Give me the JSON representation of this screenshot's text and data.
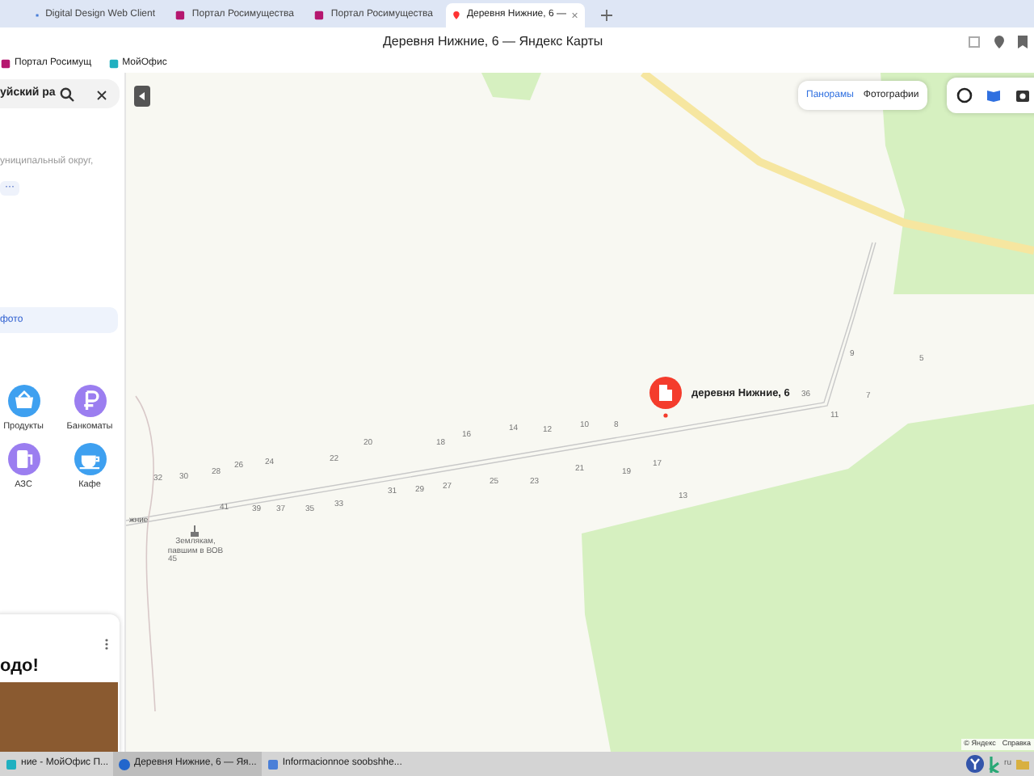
{
  "browser": {
    "tabs": [
      {
        "label": "Digital Design Web Client",
        "kind": "doc",
        "selected": false
      },
      {
        "label": "Портал Росимущества",
        "kind": "portal",
        "selected": false
      },
      {
        "label": "Портал Росимущества",
        "kind": "portal",
        "selected": false
      },
      {
        "label": "Деревня Нижние, 6 —",
        "kind": "map",
        "selected": true
      }
    ],
    "page_title": "Деревня Нижние, 6 — Яндекс Карты",
    "bookmarks": [
      {
        "label": "Портал Росимущ",
        "kind": "portal"
      },
      {
        "label": "МойОфис",
        "kind": "office"
      }
    ]
  },
  "sidebar": {
    "search": {
      "value": "уйский ра"
    },
    "address_fragment": "униципальный округ,",
    "more_chip": "···",
    "photo_link": "фото",
    "categories": [
      {
        "label": "Продукты",
        "kind": "basket",
        "color": "#3ea0f0"
      },
      {
        "label": "Банкоматы",
        "kind": "ruble",
        "color": "#9b7ef0"
      },
      {
        "label": "АЗС",
        "kind": "fuel",
        "color": "#9b7ef0"
      },
      {
        "label": "Кафе",
        "kind": "cup",
        "color": "#3ea0f0"
      }
    ],
    "promo": {
      "title": "одо!"
    }
  },
  "map": {
    "view_buttons": [
      {
        "label": "Панорамы",
        "selected": true
      },
      {
        "label": "Фотографии",
        "selected": false
      }
    ],
    "pin_label": "деревня Нижние, 6",
    "house_numbers": [
      "32",
      "30",
      "28",
      "26",
      "24",
      "22",
      "20",
      "18",
      "16",
      "14",
      "12",
      "10",
      "8",
      "36",
      "11",
      "41",
      "39",
      "37",
      "35",
      "33",
      "31",
      "29",
      "27",
      "25",
      "23",
      "21",
      "19",
      "17",
      "13",
      "9",
      "5",
      "7",
      "45"
    ],
    "place_labels": [
      "жние",
      "Землякам, павшим в ВОВ"
    ],
    "copyright": "© Яндекс",
    "links": [
      "Справка"
    ]
  },
  "taskbar": {
    "items": [
      {
        "label": "ние - МойОфис П...",
        "kind": "office",
        "selected": false
      },
      {
        "label": "Деревня Нижние, 6 — Яя...",
        "kind": "browser",
        "selected": true
      },
      {
        "label": "Informacionnoe soobshhe...",
        "kind": "doc",
        "selected": false
      }
    ],
    "lang": "ru"
  }
}
